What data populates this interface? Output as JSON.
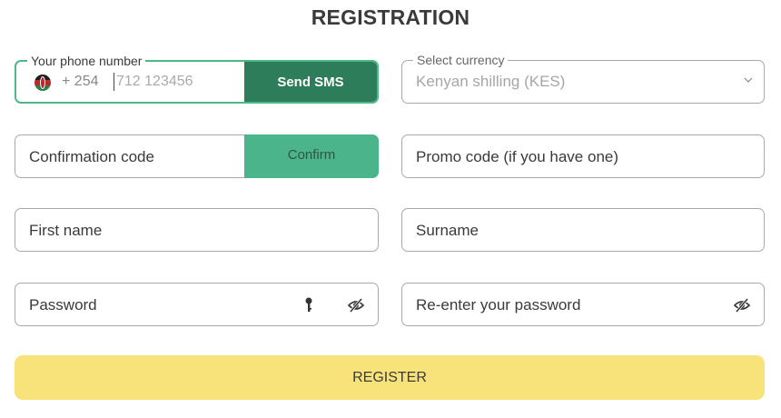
{
  "form": {
    "title": "REGISTRATION",
    "phone": {
      "label": "Your phone number",
      "prefix": "+ 254",
      "placeholder": "712 123456",
      "send_label": "Send SMS",
      "flag_icon": "kenya-flag-icon"
    },
    "currency": {
      "label": "Select currency",
      "value": "Kenyan shilling (KES)"
    },
    "confirmation": {
      "placeholder": "Confirmation code",
      "button_label": "Confirm"
    },
    "promo": {
      "placeholder": "Promo code (if you have one)"
    },
    "first_name": {
      "placeholder": "First name"
    },
    "surname": {
      "placeholder": "Surname"
    },
    "password": {
      "placeholder": "Password",
      "icons": [
        "key-icon",
        "eye-slash-icon"
      ]
    },
    "repeat_password": {
      "placeholder": "Re-enter your password",
      "icons": [
        "eye-slash-icon"
      ]
    },
    "register_label": "REGISTER"
  },
  "colors": {
    "accent_green": "#4fb889",
    "dark_green": "#2e7d5a",
    "confirm_green": "#4bb48a",
    "register_yellow": "#f8e27a"
  }
}
